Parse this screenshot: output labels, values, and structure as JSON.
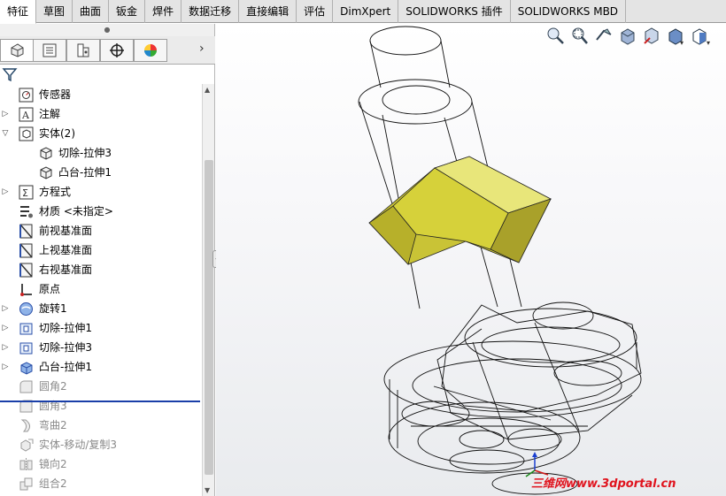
{
  "command_manager": {
    "tabs": [
      "特征",
      "草图",
      "曲面",
      "钣金",
      "焊件",
      "数据迁移",
      "直接编辑",
      "评估",
      "DimXpert",
      "SOLIDWORKS 插件",
      "SOLIDWORKS MBD"
    ],
    "active_tab": "特征"
  },
  "panel": {
    "tabs": [
      "featuremanager-tree-icon",
      "property-manager-icon",
      "configuration-manager-icon",
      "dimxpert-manager-icon",
      "display-manager-icon"
    ],
    "more_arrow": "›"
  },
  "tree": {
    "items": [
      {
        "label": "传感器",
        "icon": "sensor-icon",
        "expand": false,
        "dim": false
      },
      {
        "label": "注解",
        "icon": "annotation-icon",
        "expand": true,
        "dim": false
      },
      {
        "label": "实体(2)",
        "icon": "solid-bodies-folder-icon",
        "expand": true,
        "open": true,
        "dim": false
      },
      {
        "label": "切除-拉伸3",
        "icon": "solid-body-icon",
        "child": true,
        "dim": false
      },
      {
        "label": "凸台-拉伸1",
        "icon": "solid-body-icon",
        "child": true,
        "dim": false
      },
      {
        "label": "方程式",
        "icon": "equation-icon",
        "expand": true,
        "dim": false
      },
      {
        "label": "材质 <未指定>",
        "icon": "material-icon",
        "expand": false,
        "dim": false
      },
      {
        "label": "前视基准面",
        "icon": "plane-icon",
        "expand": false,
        "dim": false
      },
      {
        "label": "上视基准面",
        "icon": "plane-icon",
        "expand": false,
        "dim": false
      },
      {
        "label": "右视基准面",
        "icon": "plane-icon",
        "expand": false,
        "dim": false
      },
      {
        "label": "原点",
        "icon": "origin-icon",
        "expand": false,
        "dim": false
      },
      {
        "label": "旋转1",
        "icon": "revolve-icon",
        "expand": true,
        "dim": false
      },
      {
        "label": "切除-拉伸1",
        "icon": "cut-extrude-icon",
        "expand": true,
        "dim": false
      },
      {
        "label": "切除-拉伸3",
        "icon": "cut-extrude-icon",
        "expand": true,
        "dim": false
      },
      {
        "label": "凸台-拉伸1",
        "icon": "boss-extrude-icon",
        "expand": true,
        "dim": false
      },
      {
        "label": "圆角2",
        "icon": "fillet-icon",
        "expand": false,
        "dim": true
      },
      {
        "label": "圆角3",
        "icon": "fillet-icon",
        "expand": false,
        "dim": true
      },
      {
        "label": "弯曲2",
        "icon": "flex-icon",
        "expand": false,
        "dim": true
      },
      {
        "label": "实体-移动/复制3",
        "icon": "move-copy-body-icon",
        "expand": false,
        "dim": true
      },
      {
        "label": "镜向2",
        "icon": "mirror-icon",
        "expand": false,
        "dim": true
      },
      {
        "label": "组合2",
        "icon": "combine-icon",
        "expand": false,
        "dim": true
      }
    ]
  },
  "heads_up_toolbar": [
    "zoom-to-fit-icon",
    "zoom-to-area-icon",
    "previous-view-icon",
    "section-view-icon",
    "view-orientation-icon",
    "display-style-icon",
    "hide-show-items-icon"
  ],
  "watermark": "三维网www.3dportal.cn",
  "colors": {
    "body_yellow": "#d6d13a",
    "rollback_bar": "#1a3fa8",
    "watermark": "#e0141e"
  }
}
